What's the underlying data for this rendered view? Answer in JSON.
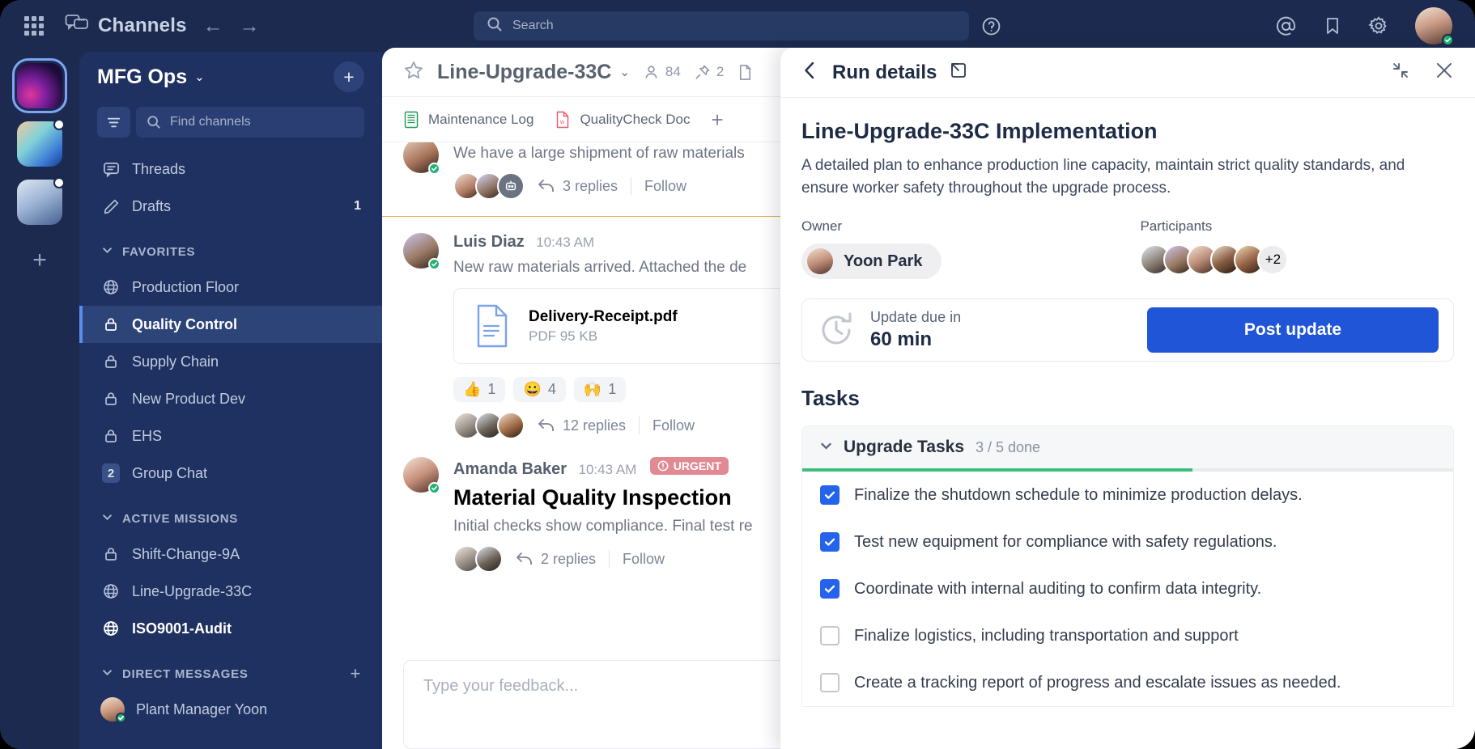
{
  "topbar": {
    "app_label": "Channels",
    "back_arrow": "←",
    "forward_arrow": "→",
    "search_placeholder": "Search",
    "icons": [
      "grid-icon",
      "channels-icon",
      "back-arrow-icon",
      "forward-arrow-icon",
      "search-icon",
      "help-icon",
      "mentions-icon",
      "bookmark-icon",
      "settings-icon",
      "user-avatar"
    ]
  },
  "rail": {
    "teams": [
      "team-1",
      "team-2",
      "team-3"
    ],
    "add_label": "+"
  },
  "sidebar": {
    "team_name": "MFG Ops",
    "caret": "⌄",
    "add_label": "+",
    "find_placeholder": "Find channels",
    "nav": [
      {
        "label": "Threads",
        "icon": "threads-icon",
        "count": ""
      },
      {
        "label": "Drafts",
        "icon": "pencil-icon",
        "count": "1"
      }
    ],
    "sections": [
      {
        "title": "FAVORITES",
        "has_plus": false,
        "items": [
          {
            "label": "Production Floor",
            "icon": "globe-icon",
            "active": false,
            "bold": false
          },
          {
            "label": "Quality Control",
            "icon": "lock-icon",
            "active": true,
            "bold": true
          },
          {
            "label": "Supply Chain",
            "icon": "lock-icon",
            "active": false,
            "bold": false
          },
          {
            "label": "New Product Dev",
            "icon": "lock-icon",
            "active": false,
            "bold": false
          },
          {
            "label": "EHS",
            "icon": "lock-icon",
            "active": false,
            "bold": false
          },
          {
            "label": "Group Chat",
            "icon": "badge-number",
            "badge": "2",
            "active": false,
            "bold": false
          }
        ]
      },
      {
        "title": "ACTIVE MISSIONS",
        "has_plus": false,
        "items": [
          {
            "label": "Shift-Change-9A",
            "icon": "lock-icon",
            "active": false,
            "bold": false
          },
          {
            "label": "Line-Upgrade-33C",
            "icon": "globe-icon",
            "active": false,
            "bold": false
          },
          {
            "label": "ISO9001-Audit",
            "icon": "globe-icon",
            "active": false,
            "bold": true
          }
        ]
      },
      {
        "title": "DIRECT MESSAGES",
        "has_plus": true,
        "items": [
          {
            "label": "Plant Manager Yoon",
            "icon": "avatar",
            "active": false,
            "bold": false
          }
        ]
      }
    ]
  },
  "channel": {
    "name": "Line-Upgrade-33C",
    "caret": "⌄",
    "members_count": "84",
    "pinned_count": "2",
    "tabs": [
      {
        "label": "Maintenance Log",
        "icon": "spreadsheet-icon"
      },
      {
        "label": "QualityCheck Doc",
        "icon": "word-doc-icon"
      }
    ],
    "add_tab_label": "+",
    "composer_placeholder": "Type your feedback..."
  },
  "messages": [
    {
      "author": "",
      "time": "",
      "text": "We have a large shipment of raw materials",
      "replies": "3 replies",
      "follow": "Follow",
      "avatars": 3
    },
    {
      "author": "Luis Diaz",
      "time": "10:43 AM",
      "text": "New raw materials arrived. Attached the de",
      "attachment": {
        "name": "Delivery-Receipt.pdf",
        "meta": "PDF 95 KB"
      },
      "reactions": [
        {
          "emoji": "👍",
          "count": "1"
        },
        {
          "emoji": "😀",
          "count": "4"
        },
        {
          "emoji": "🙌",
          "count": "1"
        }
      ],
      "replies": "12 replies",
      "follow": "Follow",
      "avatars": 3
    },
    {
      "author": "Amanda Baker",
      "time": "10:43 AM",
      "badge": "URGENT",
      "title": "Material Quality Inspection",
      "text": "Initial checks show compliance. Final test re",
      "replies": "2 replies",
      "follow": "Follow",
      "avatars": 2
    }
  ],
  "run_details": {
    "panel_title": "Run details",
    "back_icon": "chevron-left-icon",
    "open_icon": "external-link-icon",
    "collapse_icon": "collapse-icon",
    "close_icon": "close-icon",
    "title": "Line-Upgrade-33C Implementation",
    "description": "A detailed plan to enhance production line capacity, maintain strict quality standards, and ensure worker safety throughout the upgrade process.",
    "owner_label": "Owner",
    "owner_name": "Yoon Park",
    "participants_label": "Participants",
    "participants_extra": "+2",
    "participants_avatars": 5,
    "update_label": "Update due in",
    "update_value": "60 min",
    "post_update_label": "Post update",
    "tasks_heading": "Tasks",
    "task_group": {
      "name": "Upgrade Tasks",
      "progress_label": "3 / 5 done",
      "progress_pct": 60,
      "caret": "⌄",
      "tasks": [
        {
          "label": "Finalize the shutdown schedule to minimize production delays.",
          "done": true
        },
        {
          "label": "Test new equipment for compliance with safety regulations.",
          "done": true
        },
        {
          "label": "Coordinate with internal auditing to confirm data integrity.",
          "done": true
        },
        {
          "label": "Finalize logistics, including transportation and support",
          "done": false
        },
        {
          "label": "Create a tracking report of progress and escalate issues as needed.",
          "done": false
        }
      ]
    }
  },
  "colors": {
    "sidebar_bg": "#1f3160",
    "topbar_bg": "#1b2a4e",
    "accent_blue": "#1f55d6",
    "progress_green": "#3dbd7d",
    "urgent_red": "#e28a94",
    "active_item": "#2d4479"
  }
}
